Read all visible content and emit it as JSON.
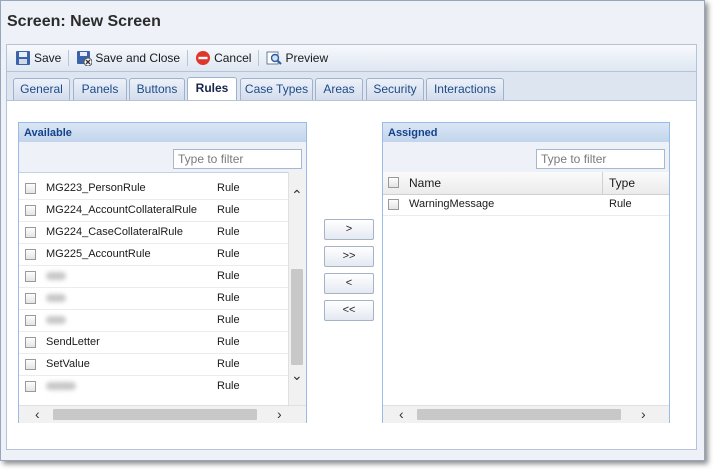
{
  "window": {
    "title": "Screen: New Screen"
  },
  "toolbar": {
    "save": "Save",
    "save_close": "Save and Close",
    "cancel": "Cancel",
    "preview": "Preview"
  },
  "tabs": [
    "General",
    "Panels",
    "Buttons",
    "Rules",
    "Case Types",
    "Areas",
    "Security",
    "Interactions"
  ],
  "active_tab": "Rules",
  "available": {
    "title": "Available",
    "filter_placeholder": "Type to filter",
    "rows": [
      {
        "name": "MG223_PersonRule",
        "type": "Rule",
        "redacted": false
      },
      {
        "name": "MG224_AccountCollateralRule",
        "type": "Rule",
        "redacted": false
      },
      {
        "name": "MG224_CaseCollateralRule",
        "type": "Rule",
        "redacted": false
      },
      {
        "name": "MG225_AccountRule",
        "type": "Rule",
        "redacted": false
      },
      {
        "name": "",
        "type": "Rule",
        "redacted": true
      },
      {
        "name": "",
        "type": "Rule",
        "redacted": true
      },
      {
        "name": "",
        "type": "Rule",
        "redacted": true
      },
      {
        "name": "SendLetter",
        "type": "Rule",
        "redacted": false
      },
      {
        "name": "SetValue",
        "type": "Rule",
        "redacted": false
      },
      {
        "name": "",
        "type": "Rule",
        "redacted": true
      }
    ]
  },
  "move_buttons": {
    "add": ">",
    "add_all": ">>",
    "remove": "<",
    "remove_all": "<<"
  },
  "assigned": {
    "title": "Assigned",
    "filter_placeholder": "Type to filter",
    "columns": {
      "name": "Name",
      "type": "Type"
    },
    "rows": [
      {
        "name": "WarningMessage",
        "type": "Rule"
      }
    ]
  }
}
